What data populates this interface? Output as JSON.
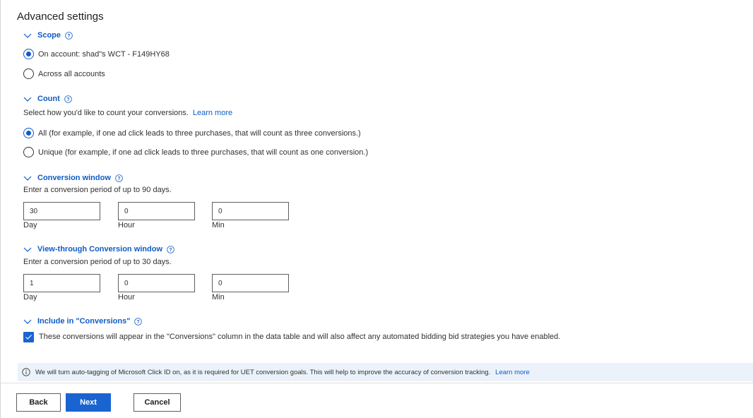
{
  "page": {
    "title": "Advanced settings"
  },
  "scope": {
    "heading": "Scope",
    "options": [
      {
        "label": "On account: shad\"s WCT - F149HY68",
        "selected": true
      },
      {
        "label": "Across all accounts",
        "selected": false
      }
    ]
  },
  "count": {
    "heading": "Count",
    "description": "Select how you'd like to count your conversions.",
    "learn_more": "Learn more",
    "options": [
      {
        "label": "All (for example, if one ad click leads to three purchases, that will count as three conversions.)",
        "selected": true
      },
      {
        "label": "Unique (for example, if one ad click leads to three purchases, that will count as one conversion.)",
        "selected": false
      }
    ]
  },
  "conversion_window": {
    "heading": "Conversion window",
    "description": "Enter a conversion period of up to 90 days.",
    "fields": [
      {
        "value": "30",
        "label": "Day"
      },
      {
        "value": "0",
        "label": "Hour"
      },
      {
        "value": "0",
        "label": "Min"
      }
    ]
  },
  "view_through_window": {
    "heading": "View-through Conversion window",
    "description": "Enter a conversion period of up to 30 days.",
    "fields": [
      {
        "value": "1",
        "label": "Day"
      },
      {
        "value": "0",
        "label": "Hour"
      },
      {
        "value": "0",
        "label": "Min"
      }
    ]
  },
  "include_conversions": {
    "heading": "Include in \"Conversions\"",
    "checked": true,
    "label": "These conversions will appear in the \"Conversions\" column in the data table and will also affect any automated bidding bid strategies you have enabled."
  },
  "banner": {
    "icon": "info-icon",
    "text": "We will turn auto-tagging of Microsoft Click ID on, as it is required for UET conversion goals. This will help to improve the accuracy of conversion tracking.",
    "learn_more": "Learn more"
  },
  "footer": {
    "back_label": "Back",
    "next_label": "Next",
    "cancel_label": "Cancel"
  },
  "colors": {
    "accent": "#0f5cc5",
    "primary_button": "#1a64d2",
    "banner_bg": "#ebf2fa"
  }
}
